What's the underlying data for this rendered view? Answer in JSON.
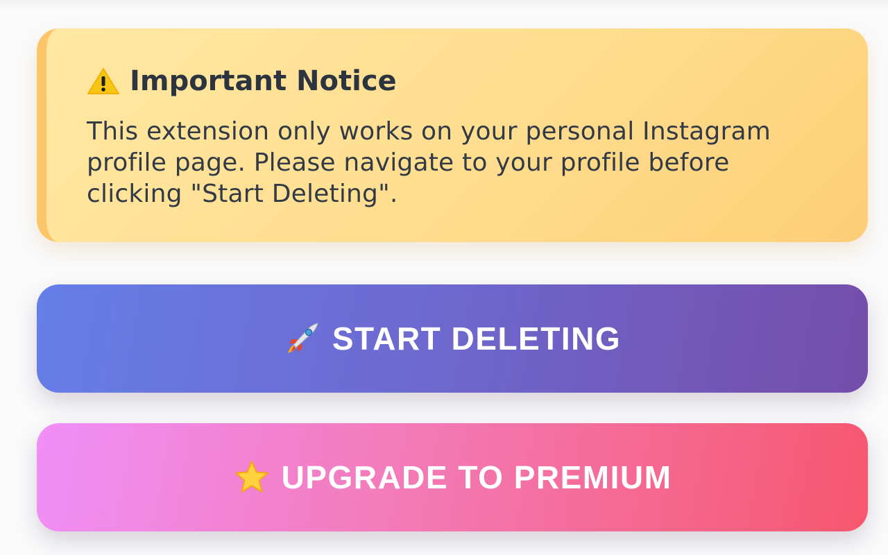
{
  "notice": {
    "icon": "warning-icon",
    "title": "Important Notice",
    "body": "This extension only works on your personal Instagram profile page. Please navigate to your profile before clicking \"Start Deleting\".",
    "accent_color": "#fcc56a"
  },
  "buttons": {
    "start": {
      "icon": "rocket-icon",
      "label": "START DELETING",
      "color_from": "#667ee8",
      "color_to": "#754daa"
    },
    "premium": {
      "icon": "star-icon",
      "label": "UPGRADE TO PREMIUM",
      "color_from": "#f08ff8",
      "color_to": "#f7576e"
    }
  }
}
